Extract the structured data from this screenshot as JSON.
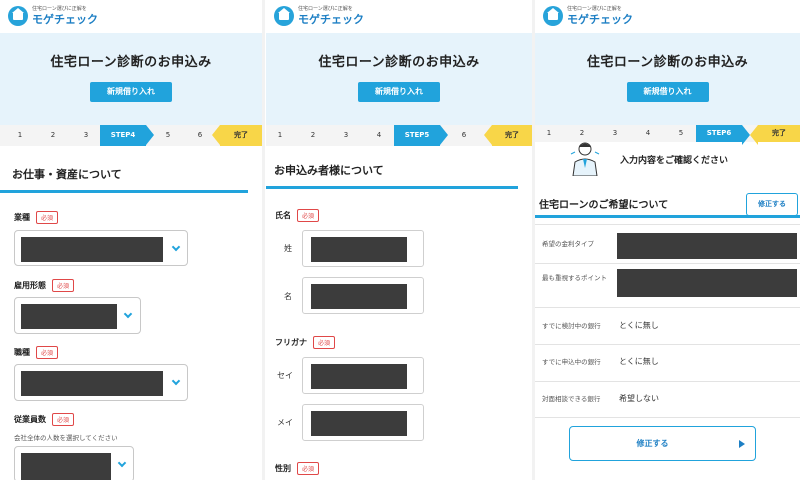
{
  "logo": {
    "tagline": "住宅ローン選びに正解を",
    "name": "モゲチェック"
  },
  "hero": {
    "title": "住宅ローン診断のお申込み",
    "button": "新規借り入れ"
  },
  "steps": {
    "panel1": {
      "items": [
        "1",
        "2",
        "3"
      ],
      "active": "STEP4",
      "after": [
        "5",
        "6"
      ],
      "done": "完了"
    },
    "panel2": {
      "items": [
        "1",
        "2",
        "3",
        "4"
      ],
      "active": "STEP5",
      "after": [
        "6"
      ],
      "done": "完了"
    },
    "panel3": {
      "items": [
        "1",
        "2",
        "3",
        "4",
        "5"
      ],
      "active": "STEP6",
      "after": [],
      "done": "完了"
    }
  },
  "panel1": {
    "section_title": "お仕事・資産について",
    "required": "必須",
    "fields": [
      {
        "label": "業種"
      },
      {
        "label": "雇用形態"
      },
      {
        "label": "職種"
      },
      {
        "label": "従業員数",
        "hint": "会社全体の人数を選択してください"
      }
    ]
  },
  "panel2": {
    "section_title": "お申込み者様について",
    "required": "必須",
    "name_label": "氏名",
    "sei_kanji": "姓",
    "mei_kanji": "名",
    "kana_label": "フリガナ",
    "sei_kana": "セイ",
    "mei_kana": "メイ",
    "gender_label": "性別"
  },
  "panel3": {
    "confirm_heading": "入力内容をご確認ください",
    "section_title": "住宅ローンのご希望について",
    "fix_button": "修正する",
    "rows": [
      {
        "label": "希望の金利タイプ",
        "value": ""
      },
      {
        "label": "最も重視するポイント",
        "value": ""
      },
      {
        "label": "すでに検討中の銀行",
        "value": "とくに無し"
      },
      {
        "label": "すでに申込中の銀行",
        "value": "とくに無し"
      },
      {
        "label": "対面相談できる銀行",
        "value": "希望しない"
      }
    ],
    "bottom_button": "修正する"
  }
}
